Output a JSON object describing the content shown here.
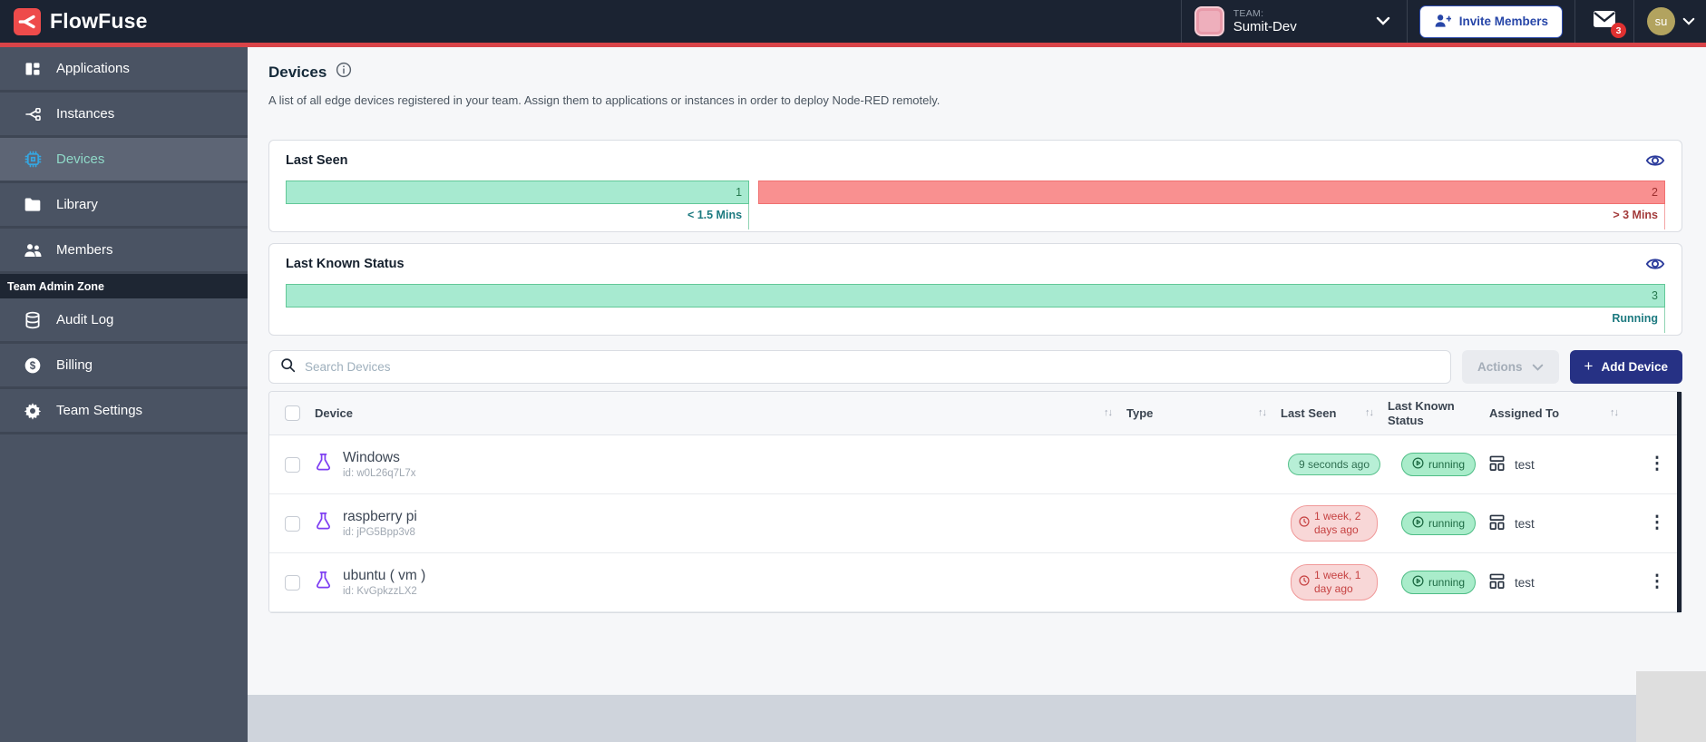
{
  "header": {
    "logo_text": "FlowFuse",
    "team_label": "TEAM:",
    "team_name": "Sumit-Dev",
    "invite_button_label": "Invite Members",
    "notification_count": "3",
    "avatar_initials": "su"
  },
  "sidebar": {
    "items": [
      {
        "label": "Applications"
      },
      {
        "label": "Instances"
      },
      {
        "label": "Devices"
      },
      {
        "label": "Library"
      },
      {
        "label": "Members"
      }
    ],
    "admin_section_label": "Team Admin Zone",
    "admin_items": [
      {
        "label": "Audit Log"
      },
      {
        "label": "Billing"
      },
      {
        "label": "Team Settings"
      }
    ]
  },
  "page": {
    "title": "Devices",
    "description": "A list of all edge devices registered in your team. Assign them to applications or instances in order to deploy Node-RED remotely."
  },
  "chart_data": [
    {
      "type": "bar",
      "title": "Last Seen",
      "categories": [
        "< 1.5 Mins",
        "> 3 Mins"
      ],
      "values": [
        1,
        2
      ],
      "colors": [
        "#a7ead0",
        "#f99090"
      ],
      "orientation": "horizontal-stacked"
    },
    {
      "type": "bar",
      "title": "Last Known Status",
      "categories": [
        "Running"
      ],
      "values": [
        3
      ],
      "colors": [
        "#a7ead0"
      ],
      "orientation": "horizontal-stacked"
    }
  ],
  "cards": {
    "last_seen": {
      "title": "Last Seen",
      "segments": [
        {
          "value": "1",
          "label": "< 1.5 Mins"
        },
        {
          "value": "2",
          "label": "> 3 Mins"
        }
      ]
    },
    "last_known_status": {
      "title": "Last Known Status",
      "segments": [
        {
          "value": "3",
          "label": "Running"
        }
      ]
    }
  },
  "toolbar": {
    "search_placeholder": "Search Devices",
    "actions_label": "Actions",
    "add_device_plus": "+",
    "add_device_label": "Add Device"
  },
  "table": {
    "headers": {
      "device": "Device",
      "type": "Type",
      "last_seen": "Last Seen",
      "last_known_status": "Last Known Status",
      "assigned_to": "Assigned To"
    },
    "sort_glyph": "↑↓",
    "kebab_glyph": "⋮",
    "rows": [
      {
        "name": "Windows",
        "id": "id: w0L26q7L7x",
        "last_seen": "9 seconds ago",
        "last_seen_state": "ok",
        "status": "running",
        "assigned_to": "test"
      },
      {
        "name": "raspberry pi",
        "id": "id: jPG5Bpp3v8",
        "last_seen": "1 week, 2 days ago",
        "last_seen_state": "stale",
        "status": "running",
        "assigned_to": "test"
      },
      {
        "name": "ubuntu ( vm )",
        "id": "id: KvGpkzzLX2",
        "last_seen": "1 week, 1 day ago",
        "last_seen_state": "stale",
        "status": "running",
        "assigned_to": "test"
      }
    ]
  },
  "colors": {
    "accent_red": "#d94348",
    "navbar_bg": "#1b2332",
    "primary_indigo": "#263184",
    "green_fill": "#a7ead0",
    "green_border": "#62c897",
    "red_fill": "#f99090",
    "teal_label": "#1d7a80",
    "badge_red_text": "#c64242"
  }
}
